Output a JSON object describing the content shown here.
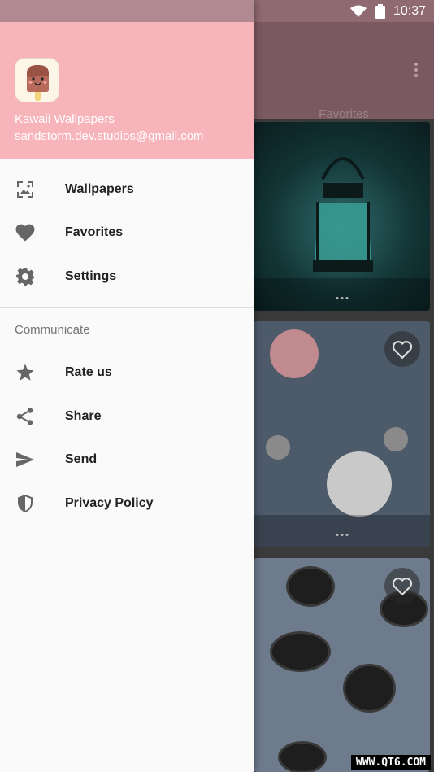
{
  "status_bar": {
    "time": "10:37"
  },
  "drawer": {
    "app_name": "Kawaii Wallpapers",
    "email": "sandstorm.dev.studios@gmail.com",
    "main_items": [
      {
        "label": "Wallpapers",
        "icon": "wallpaper-icon"
      },
      {
        "label": "Favorites",
        "icon": "heart-icon"
      },
      {
        "label": "Settings",
        "icon": "gear-icon"
      }
    ],
    "section_title": "Communicate",
    "communicate_items": [
      {
        "label": "Rate us",
        "icon": "star-icon"
      },
      {
        "label": "Share",
        "icon": "share-icon"
      },
      {
        "label": "Send",
        "icon": "send-icon"
      },
      {
        "label": "Privacy Policy",
        "icon": "shield-icon"
      }
    ]
  },
  "background": {
    "tab_label": "Favorites"
  },
  "watermark": "WWW.QT6.COM",
  "colors": {
    "drawer_header": "#f8b4bb",
    "drawer_bg": "#fafafa",
    "toolbar_dimmed": "#7a5a60"
  }
}
